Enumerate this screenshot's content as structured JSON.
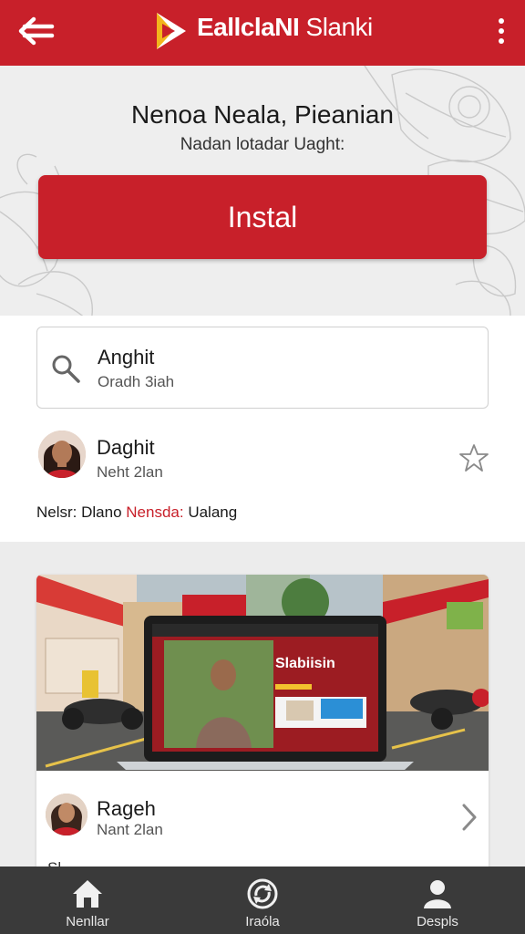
{
  "appbar": {
    "title_bold": "EallclaNI",
    "title_light": " Slanki",
    "back_icon": "back-arrow-icon",
    "menu_icon": "more-vert-icon",
    "accent_color": "#c8202a"
  },
  "hero": {
    "title": "Nenoa Neala, Pieanian",
    "subtitle": "Nadan lotadar Uaght:",
    "install_label": "Instal"
  },
  "search": {
    "title": "Anghit",
    "subtitle": "Oradh 3iah",
    "icon": "search-icon"
  },
  "profile": {
    "name": "Daghit",
    "subtitle": "Neht 2lan",
    "star_icon": "star-outline-icon"
  },
  "meta": {
    "prefix": "Nelsr: Dlano ",
    "highlight": "Nensda:",
    "suffix": " Ualang"
  },
  "card": {
    "laptop_headline": "Slabiisin",
    "name": "Rageh",
    "subtitle": "Nant 2lan",
    "cut_text": "Sl",
    "chevron_icon": "chevron-right-icon"
  },
  "bottom_nav": [
    {
      "label": "Nenllar",
      "icon": "home-icon"
    },
    {
      "label": "Iraóla",
      "icon": "sync-icon"
    },
    {
      "label": "Despls",
      "icon": "person-icon"
    }
  ]
}
